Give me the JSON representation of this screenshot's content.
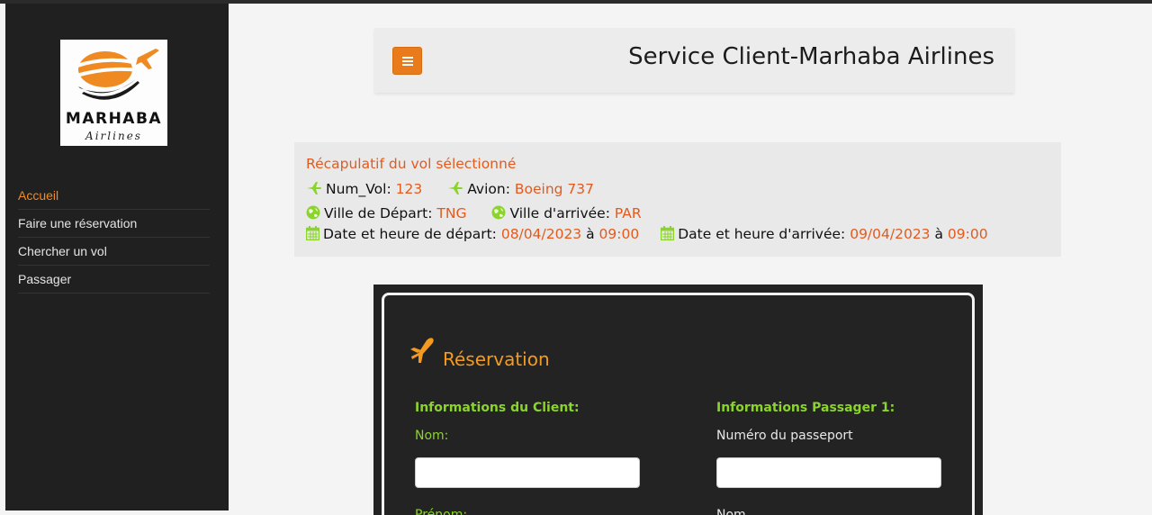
{
  "sidebar": {
    "logo": {
      "brand": "MARHABA",
      "sub": "Airlines"
    },
    "items": [
      {
        "label": "Accueil",
        "active": true
      },
      {
        "label": "Faire une réservation"
      },
      {
        "label": "Chercher un vol"
      },
      {
        "label": "Passager"
      }
    ]
  },
  "header": {
    "title": "Service Client-Marhaba Airlines",
    "menu_icon": "hamburger-icon"
  },
  "recap": {
    "title": "Récapulatif du vol sélectionné",
    "num_vol_label": "Num_Vol:",
    "num_vol": "123",
    "avion_label": "Avion:",
    "avion": "Boeing 737",
    "ville_depart_label": "Ville de Départ:",
    "ville_depart": "TNG",
    "ville_arrivee_label": "Ville d'arrivée:",
    "ville_arrivee": "PAR",
    "date_depart_label": "Date et heure de départ:",
    "date_depart": "08/04/2023",
    "a1": "à",
    "heure_depart": "09:00",
    "date_arrivee_label": "Date et heure d'arrivée:",
    "date_arrivee": "09/04/2023",
    "a2": "à",
    "heure_arrivee": "09:00"
  },
  "reservation": {
    "title": "Réservation",
    "client_header": "Informations du Client:",
    "passenger_header": "Informations Passager 1:",
    "client_nom_label": "Nom:",
    "client_prenom_label": "Prénom:",
    "passport_label": "Numéro du passeport",
    "passenger_nom_label": "Nom",
    "client_nom_value": "",
    "passport_value": ""
  },
  "colors": {
    "accent": "#ea7b1d",
    "value": "#e45a1c",
    "green": "#8bd42b",
    "sidebar": "#202020"
  }
}
